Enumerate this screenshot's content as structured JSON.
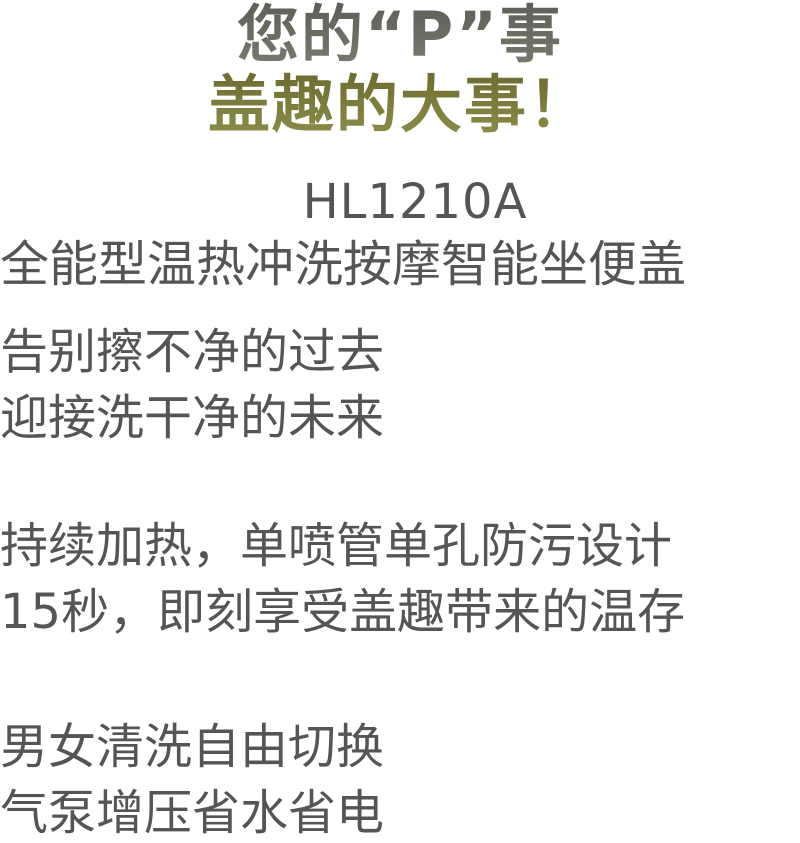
{
  "headline": {
    "line1": "您的“P”事",
    "line2": "盖趣的大事！"
  },
  "product": {
    "model": "HL1210A",
    "name": "全能型温热冲洗按摩智能坐便盖"
  },
  "copy": {
    "group1": [
      "告别擦不净的过去",
      "迎接洗干净的未来"
    ],
    "group2": [
      "持续加热，单喷管单孔防污设计",
      "15秒，即刻享受盖趣带来的温存"
    ],
    "group3": [
      "男女清洗自由切换",
      "气泵增压省水省电"
    ]
  },
  "colors": {
    "headline_gray": "#6b6b63",
    "headline_olive": "#7a7a3c",
    "body_text": "#555555"
  }
}
